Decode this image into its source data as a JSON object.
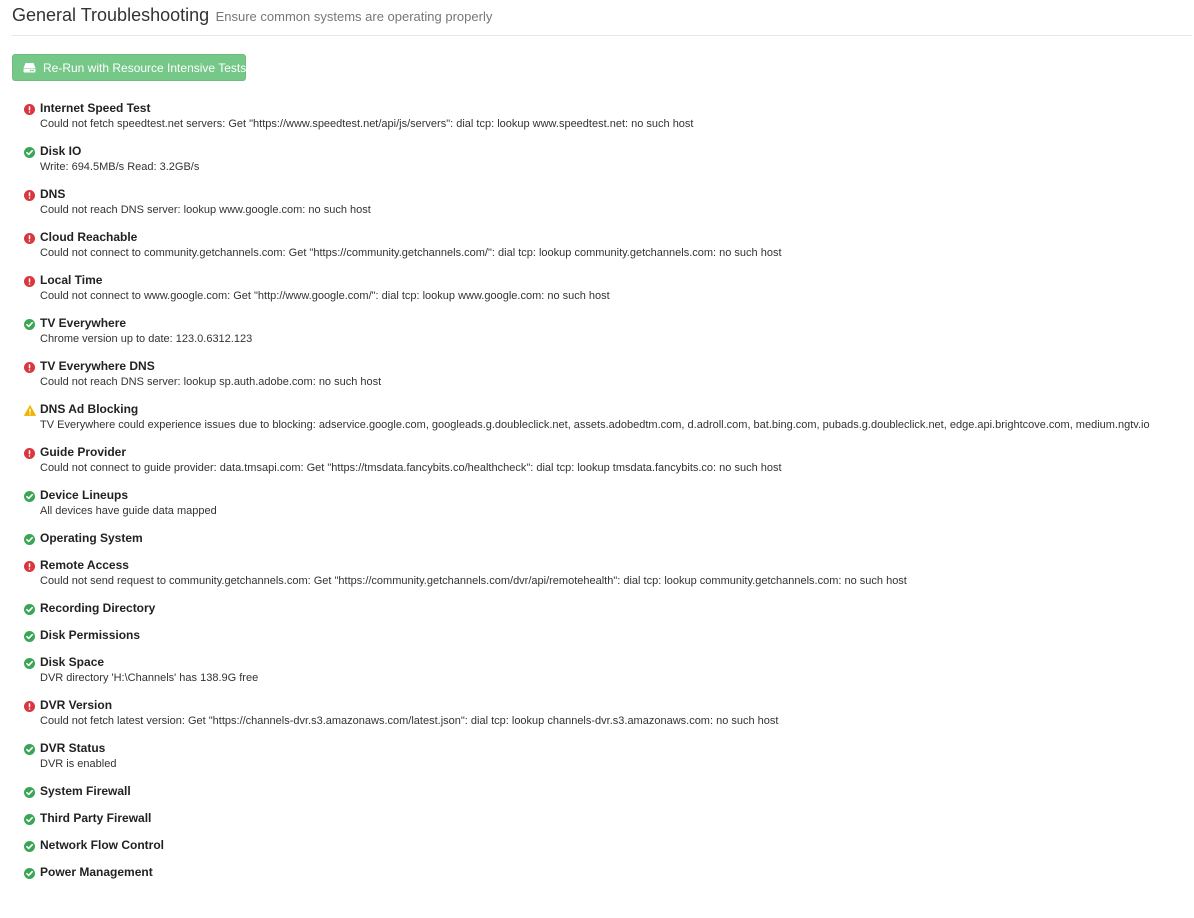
{
  "header": {
    "title": "General Troubleshooting",
    "subtitle": "Ensure common systems are operating properly"
  },
  "actions": {
    "rerun_label": "Re-Run with Resource Intensive Tests",
    "rerun_icon": "hard-drive-icon"
  },
  "colors": {
    "pass": "#3aa655",
    "fail": "#d9363e",
    "warning": "#f0b400",
    "button": "#75c887"
  },
  "checks": [
    {
      "name": "Internet Speed Test",
      "status": "fail",
      "detail": "Could not fetch speedtest.net servers: Get \"https://www.speedtest.net/api/js/servers\": dial tcp: lookup www.speedtest.net: no such host"
    },
    {
      "name": "Disk IO",
      "status": "pass",
      "detail": "Write: 694.5MB/s Read: 3.2GB/s"
    },
    {
      "name": "DNS",
      "status": "fail",
      "detail": "Could not reach DNS server: lookup www.google.com: no such host"
    },
    {
      "name": "Cloud Reachable",
      "status": "fail",
      "detail": "Could not connect to community.getchannels.com: Get \"https://community.getchannels.com/\": dial tcp: lookup community.getchannels.com: no such host"
    },
    {
      "name": "Local Time",
      "status": "fail",
      "detail": "Could not connect to www.google.com: Get \"http://www.google.com/\": dial tcp: lookup www.google.com: no such host"
    },
    {
      "name": "TV Everywhere",
      "status": "pass",
      "detail": "Chrome version up to date: 123.0.6312.123"
    },
    {
      "name": "TV Everywhere DNS",
      "status": "fail",
      "detail": "Could not reach DNS server: lookup sp.auth.adobe.com: no such host"
    },
    {
      "name": "DNS Ad Blocking",
      "status": "warning",
      "detail": "TV Everywhere could experience issues due to blocking: adservice.google.com, googleads.g.doubleclick.net, assets.adobedtm.com, d.adroll.com, bat.bing.com, pubads.g.doubleclick.net, edge.api.brightcove.com, medium.ngtv.io"
    },
    {
      "name": "Guide Provider",
      "status": "fail",
      "detail": "Could not connect to guide provider: data.tmsapi.com: Get \"https://tmsdata.fancybits.co/healthcheck\": dial tcp: lookup tmsdata.fancybits.co: no such host"
    },
    {
      "name": "Device Lineups",
      "status": "pass",
      "detail": "All devices have guide data mapped"
    },
    {
      "name": "Operating System",
      "status": "pass",
      "detail": ""
    },
    {
      "name": "Remote Access",
      "status": "fail",
      "detail": "Could not send request to community.getchannels.com: Get \"https://community.getchannels.com/dvr/api/remotehealth\": dial tcp: lookup community.getchannels.com: no such host"
    },
    {
      "name": "Recording Directory",
      "status": "pass",
      "detail": ""
    },
    {
      "name": "Disk Permissions",
      "status": "pass",
      "detail": ""
    },
    {
      "name": "Disk Space",
      "status": "pass",
      "detail": "DVR directory 'H:\\Channels' has 138.9G free"
    },
    {
      "name": "DVR Version",
      "status": "fail",
      "detail": "Could not fetch latest version: Get \"https://channels-dvr.s3.amazonaws.com/latest.json\": dial tcp: lookup channels-dvr.s3.amazonaws.com: no such host"
    },
    {
      "name": "DVR Status",
      "status": "pass",
      "detail": "DVR is enabled"
    },
    {
      "name": "System Firewall",
      "status": "pass",
      "detail": ""
    },
    {
      "name": "Third Party Firewall",
      "status": "pass",
      "detail": ""
    },
    {
      "name": "Network Flow Control",
      "status": "pass",
      "detail": ""
    },
    {
      "name": "Power Management",
      "status": "pass",
      "detail": ""
    }
  ]
}
